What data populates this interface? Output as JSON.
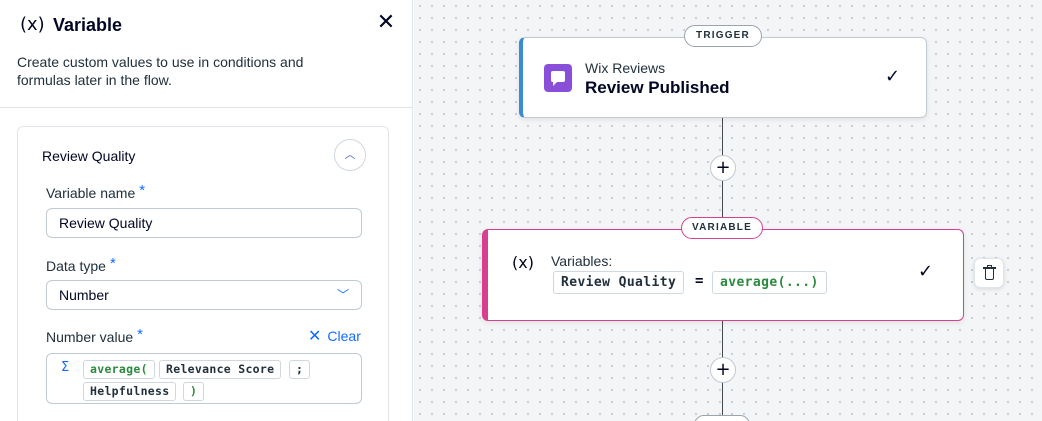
{
  "panel": {
    "icon": "(x)",
    "title": "Variable",
    "close_icon": "✕",
    "description": "Create custom values to use in conditions and formulas later in the flow."
  },
  "card": {
    "title": "Review Quality",
    "collapse_icon": "chevron-up-icon",
    "fields": {
      "variable_name": {
        "label": "Variable name",
        "required": "*",
        "value": "Review Quality"
      },
      "data_type": {
        "label": "Data type",
        "required": "*",
        "value": "Number"
      },
      "number_value": {
        "label": "Number value",
        "required": "*",
        "clear_label": "Clear",
        "sigma": "Σ",
        "tokens": [
          "average(",
          "Relevance Score",
          ";",
          "Helpfulness",
          ")"
        ]
      }
    }
  },
  "canvas": {
    "trigger": {
      "badge": "TRIGGER",
      "app": "Wix Reviews",
      "event": "Review Published",
      "check": "✓"
    },
    "plus": "+",
    "variable_node": {
      "badge": "VARIABLE",
      "icon": "(x)",
      "label": "Variables:",
      "name": "Review Quality",
      "equals": "=",
      "value": "average(...)",
      "check": "✓"
    },
    "colors": {
      "trigger_accent": "#3b8bd4",
      "variable_accent": "#d8408f",
      "link": "#116dff",
      "app_icon": "#8a4fd8",
      "fn_token": "#2a8a3e"
    }
  }
}
